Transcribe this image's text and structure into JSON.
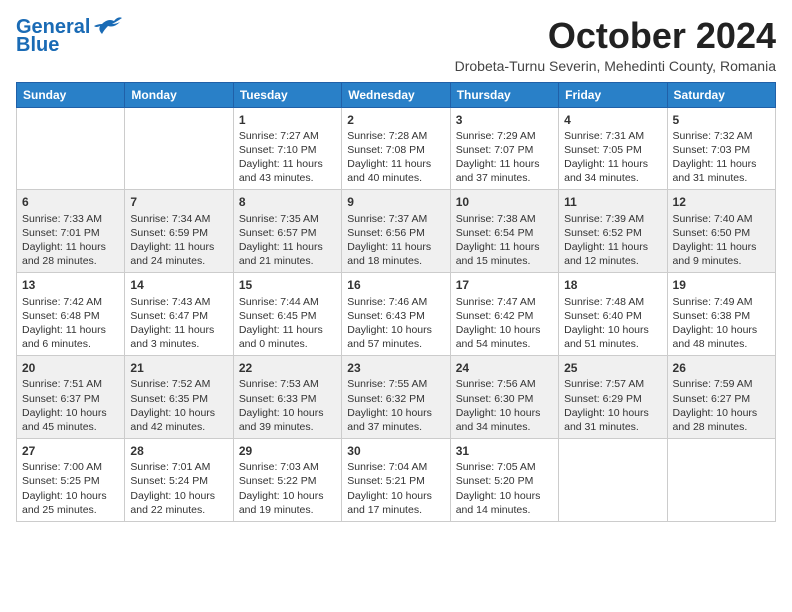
{
  "header": {
    "logo_line1": "General",
    "logo_line2": "Blue",
    "month": "October 2024",
    "location": "Drobeta-Turnu Severin, Mehedinti County, Romania"
  },
  "weekdays": [
    "Sunday",
    "Monday",
    "Tuesday",
    "Wednesday",
    "Thursday",
    "Friday",
    "Saturday"
  ],
  "weeks": [
    [
      {
        "day": "",
        "info": ""
      },
      {
        "day": "",
        "info": ""
      },
      {
        "day": "1",
        "info": "Sunrise: 7:27 AM\nSunset: 7:10 PM\nDaylight: 11 hours\nand 43 minutes."
      },
      {
        "day": "2",
        "info": "Sunrise: 7:28 AM\nSunset: 7:08 PM\nDaylight: 11 hours\nand 40 minutes."
      },
      {
        "day": "3",
        "info": "Sunrise: 7:29 AM\nSunset: 7:07 PM\nDaylight: 11 hours\nand 37 minutes."
      },
      {
        "day": "4",
        "info": "Sunrise: 7:31 AM\nSunset: 7:05 PM\nDaylight: 11 hours\nand 34 minutes."
      },
      {
        "day": "5",
        "info": "Sunrise: 7:32 AM\nSunset: 7:03 PM\nDaylight: 11 hours\nand 31 minutes."
      }
    ],
    [
      {
        "day": "6",
        "info": "Sunrise: 7:33 AM\nSunset: 7:01 PM\nDaylight: 11 hours\nand 28 minutes."
      },
      {
        "day": "7",
        "info": "Sunrise: 7:34 AM\nSunset: 6:59 PM\nDaylight: 11 hours\nand 24 minutes."
      },
      {
        "day": "8",
        "info": "Sunrise: 7:35 AM\nSunset: 6:57 PM\nDaylight: 11 hours\nand 21 minutes."
      },
      {
        "day": "9",
        "info": "Sunrise: 7:37 AM\nSunset: 6:56 PM\nDaylight: 11 hours\nand 18 minutes."
      },
      {
        "day": "10",
        "info": "Sunrise: 7:38 AM\nSunset: 6:54 PM\nDaylight: 11 hours\nand 15 minutes."
      },
      {
        "day": "11",
        "info": "Sunrise: 7:39 AM\nSunset: 6:52 PM\nDaylight: 11 hours\nand 12 minutes."
      },
      {
        "day": "12",
        "info": "Sunrise: 7:40 AM\nSunset: 6:50 PM\nDaylight: 11 hours\nand 9 minutes."
      }
    ],
    [
      {
        "day": "13",
        "info": "Sunrise: 7:42 AM\nSunset: 6:48 PM\nDaylight: 11 hours\nand 6 minutes."
      },
      {
        "day": "14",
        "info": "Sunrise: 7:43 AM\nSunset: 6:47 PM\nDaylight: 11 hours\nand 3 minutes."
      },
      {
        "day": "15",
        "info": "Sunrise: 7:44 AM\nSunset: 6:45 PM\nDaylight: 11 hours\nand 0 minutes."
      },
      {
        "day": "16",
        "info": "Sunrise: 7:46 AM\nSunset: 6:43 PM\nDaylight: 10 hours\nand 57 minutes."
      },
      {
        "day": "17",
        "info": "Sunrise: 7:47 AM\nSunset: 6:42 PM\nDaylight: 10 hours\nand 54 minutes."
      },
      {
        "day": "18",
        "info": "Sunrise: 7:48 AM\nSunset: 6:40 PM\nDaylight: 10 hours\nand 51 minutes."
      },
      {
        "day": "19",
        "info": "Sunrise: 7:49 AM\nSunset: 6:38 PM\nDaylight: 10 hours\nand 48 minutes."
      }
    ],
    [
      {
        "day": "20",
        "info": "Sunrise: 7:51 AM\nSunset: 6:37 PM\nDaylight: 10 hours\nand 45 minutes."
      },
      {
        "day": "21",
        "info": "Sunrise: 7:52 AM\nSunset: 6:35 PM\nDaylight: 10 hours\nand 42 minutes."
      },
      {
        "day": "22",
        "info": "Sunrise: 7:53 AM\nSunset: 6:33 PM\nDaylight: 10 hours\nand 39 minutes."
      },
      {
        "day": "23",
        "info": "Sunrise: 7:55 AM\nSunset: 6:32 PM\nDaylight: 10 hours\nand 37 minutes."
      },
      {
        "day": "24",
        "info": "Sunrise: 7:56 AM\nSunset: 6:30 PM\nDaylight: 10 hours\nand 34 minutes."
      },
      {
        "day": "25",
        "info": "Sunrise: 7:57 AM\nSunset: 6:29 PM\nDaylight: 10 hours\nand 31 minutes."
      },
      {
        "day": "26",
        "info": "Sunrise: 7:59 AM\nSunset: 6:27 PM\nDaylight: 10 hours\nand 28 minutes."
      }
    ],
    [
      {
        "day": "27",
        "info": "Sunrise: 7:00 AM\nSunset: 5:25 PM\nDaylight: 10 hours\nand 25 minutes."
      },
      {
        "day": "28",
        "info": "Sunrise: 7:01 AM\nSunset: 5:24 PM\nDaylight: 10 hours\nand 22 minutes."
      },
      {
        "day": "29",
        "info": "Sunrise: 7:03 AM\nSunset: 5:22 PM\nDaylight: 10 hours\nand 19 minutes."
      },
      {
        "day": "30",
        "info": "Sunrise: 7:04 AM\nSunset: 5:21 PM\nDaylight: 10 hours\nand 17 minutes."
      },
      {
        "day": "31",
        "info": "Sunrise: 7:05 AM\nSunset: 5:20 PM\nDaylight: 10 hours\nand 14 minutes."
      },
      {
        "day": "",
        "info": ""
      },
      {
        "day": "",
        "info": ""
      }
    ]
  ]
}
